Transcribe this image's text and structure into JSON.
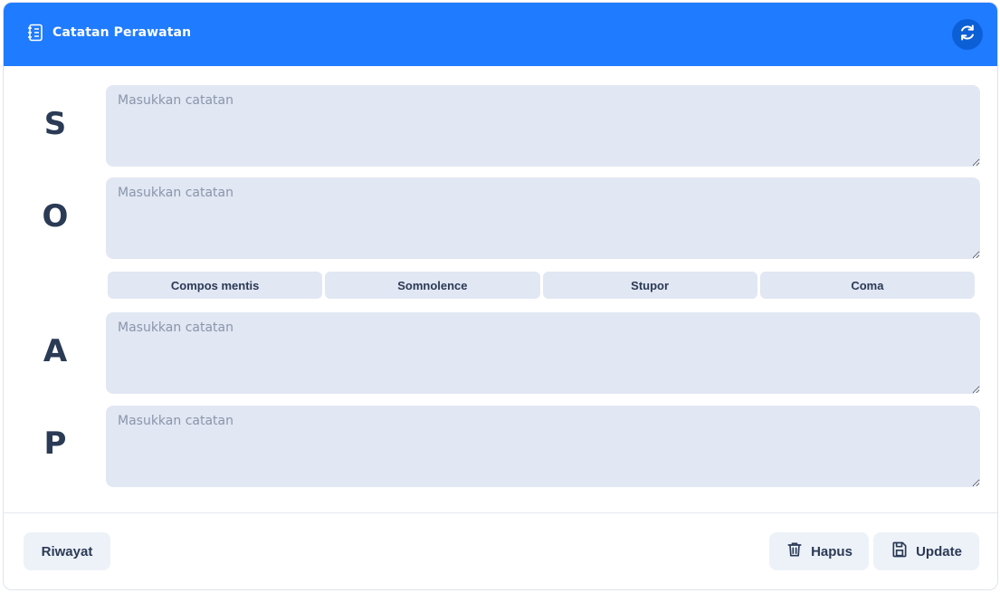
{
  "header": {
    "title": "Catatan Perawatan",
    "icon": "notebook-icon",
    "refresh_icon": "refresh-icon"
  },
  "soap": [
    {
      "letter": "S",
      "placeholder": "Masukkan catatan",
      "value": ""
    },
    {
      "letter": "O",
      "placeholder": "Masukkan catatan",
      "value": ""
    },
    {
      "letter": "A",
      "placeholder": "Masukkan catatan",
      "value": ""
    },
    {
      "letter": "P",
      "placeholder": "Masukkan catatan",
      "value": ""
    }
  ],
  "consciousness": [
    "Compos mentis",
    "Somnolence",
    "Stupor",
    "Coma"
  ],
  "footer": {
    "history_label": "Riwayat",
    "delete_label": "Hapus",
    "update_label": "Update"
  },
  "colors": {
    "header": "#1f7bff",
    "field_bg": "#e1e7f3",
    "button_bg": "#edf2f9",
    "text": "#2b3a55"
  }
}
